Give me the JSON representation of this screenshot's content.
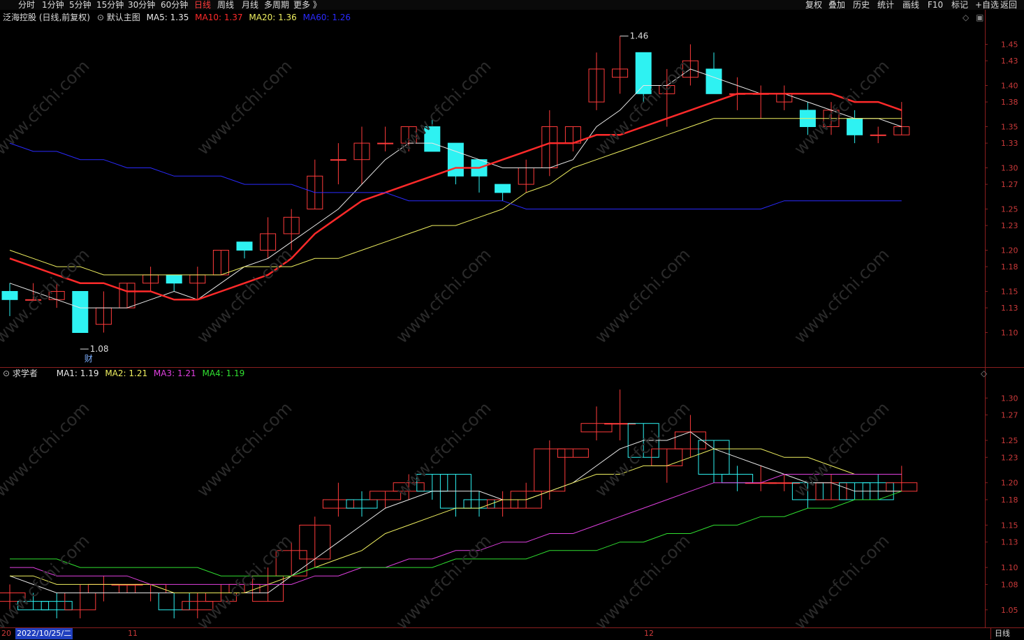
{
  "toolbar": {
    "left": [
      "分时",
      "1分钟",
      "5分钟",
      "15分钟",
      "30分钟",
      "60分钟",
      "日线",
      "周线",
      "月线",
      "多周期",
      "更多 》"
    ],
    "active_index": 6,
    "right": [
      "复权",
      "叠加",
      "历史",
      "统计",
      "画线",
      "F10",
      "标记",
      "+自选",
      "返回"
    ]
  },
  "main_panel": {
    "title": "泛海控股 (日线,前复权)",
    "indicator": "默认主图",
    "ma": [
      {
        "label": "MA5: 1.35",
        "color": "#e8e8e8"
      },
      {
        "label": "MA10: 1.37",
        "color": "#ff2a2a"
      },
      {
        "label": "MA20: 1.36",
        "color": "#f0f060"
      },
      {
        "label": "MA60: 1.26",
        "color": "#2a2aff"
      }
    ],
    "high_label": "1.46",
    "low_label": "1.08",
    "fin_marker": "财"
  },
  "sub_panel": {
    "title": "求学者",
    "ma": [
      {
        "label": "MA1: 1.19",
        "color": "#e8e8e8"
      },
      {
        "label": "MA2: 1.21",
        "color": "#f0f060"
      },
      {
        "label": "MA3: 1.21",
        "color": "#e040e0"
      },
      {
        "label": "MA4: 1.19",
        "color": "#30e030"
      }
    ]
  },
  "bottom": {
    "cursor_date": "2022/10/25/二",
    "x_ticks": [
      "20",
      "11",
      "12"
    ],
    "period": "日线"
  },
  "watermark": "www.cfchi.com",
  "colors": {
    "up": "#ff3b3b",
    "down": "#2ef2f2",
    "axis": "#8a1f1f",
    "axis_text": "#cc3a3a"
  },
  "chart_data": [
    {
      "type": "candlestick",
      "title": "泛海控股 (日线,前复权)",
      "y_ticks": [
        1.1,
        1.13,
        1.15,
        1.18,
        1.2,
        1.23,
        1.25,
        1.28,
        1.3,
        1.33,
        1.35,
        1.38,
        1.4,
        1.43,
        1.45
      ],
      "y_labels": [
        "1.10",
        "1.13",
        "1.15",
        "1.18",
        "1.20",
        "1.23",
        "1.25",
        "1.27",
        "1.30",
        "1.33",
        "1.35",
        "1.38",
        "1.40",
        "1.43",
        "1.45"
      ],
      "ylim": [
        1.075,
        1.475
      ],
      "candles": [
        [
          1.15,
          1.14,
          1.16,
          1.12
        ],
        [
          1.14,
          1.14,
          1.16,
          1.14
        ],
        [
          1.14,
          1.15,
          1.16,
          1.13
        ],
        [
          1.15,
          1.1,
          1.15,
          1.1
        ],
        [
          1.11,
          1.13,
          1.15,
          1.1
        ],
        [
          1.13,
          1.16,
          1.16,
          1.13
        ],
        [
          1.16,
          1.17,
          1.18,
          1.15
        ],
        [
          1.17,
          1.16,
          1.17,
          1.15
        ],
        [
          1.16,
          1.17,
          1.18,
          1.14
        ],
        [
          1.17,
          1.2,
          1.2,
          1.17
        ],
        [
          1.21,
          1.2,
          1.21,
          1.19
        ],
        [
          1.2,
          1.22,
          1.24,
          1.19
        ],
        [
          1.22,
          1.24,
          1.25,
          1.2
        ],
        [
          1.25,
          1.29,
          1.31,
          1.25
        ],
        [
          1.31,
          1.31,
          1.33,
          1.28
        ],
        [
          1.31,
          1.33,
          1.35,
          1.28
        ],
        [
          1.33,
          1.33,
          1.35,
          1.32
        ],
        [
          1.33,
          1.35,
          1.35,
          1.32
        ],
        [
          1.35,
          1.32,
          1.36,
          1.32
        ],
        [
          1.33,
          1.29,
          1.33,
          1.28
        ],
        [
          1.31,
          1.29,
          1.31,
          1.27
        ],
        [
          1.28,
          1.27,
          1.28,
          1.26
        ],
        [
          1.28,
          1.3,
          1.31,
          1.27
        ],
        [
          1.3,
          1.35,
          1.37,
          1.29
        ],
        [
          1.33,
          1.35,
          1.35,
          1.32
        ],
        [
          1.38,
          1.42,
          1.44,
          1.37
        ],
        [
          1.41,
          1.42,
          1.46,
          1.39
        ],
        [
          1.44,
          1.39,
          1.44,
          1.38
        ],
        [
          1.39,
          1.4,
          1.42,
          1.35
        ],
        [
          1.41,
          1.43,
          1.45,
          1.4
        ],
        [
          1.42,
          1.39,
          1.44,
          1.39
        ],
        [
          1.39,
          1.39,
          1.41,
          1.37
        ],
        [
          1.39,
          1.39,
          1.4,
          1.36
        ],
        [
          1.38,
          1.39,
          1.4,
          1.37
        ],
        [
          1.37,
          1.35,
          1.38,
          1.34
        ],
        [
          1.35,
          1.37,
          1.38,
          1.34
        ],
        [
          1.36,
          1.34,
          1.37,
          1.33
        ],
        [
          1.34,
          1.34,
          1.35,
          1.33
        ],
        [
          1.34,
          1.35,
          1.38,
          1.34
        ]
      ],
      "series": [
        {
          "name": "MA5",
          "values": [
            1.16,
            1.15,
            1.14,
            1.13,
            1.13,
            1.13,
            1.14,
            1.15,
            1.14,
            1.16,
            1.18,
            1.19,
            1.21,
            1.23,
            1.25,
            1.28,
            1.31,
            1.33,
            1.33,
            1.32,
            1.31,
            1.3,
            1.3,
            1.3,
            1.31,
            1.35,
            1.37,
            1.4,
            1.4,
            1.42,
            1.41,
            1.4,
            1.39,
            1.39,
            1.38,
            1.37,
            1.36,
            1.36,
            1.35
          ]
        },
        {
          "name": "MA10",
          "values": [
            1.19,
            1.18,
            1.17,
            1.16,
            1.16,
            1.15,
            1.15,
            1.14,
            1.14,
            1.15,
            1.16,
            1.17,
            1.19,
            1.22,
            1.24,
            1.26,
            1.27,
            1.28,
            1.29,
            1.3,
            1.3,
            1.31,
            1.32,
            1.33,
            1.33,
            1.34,
            1.34,
            1.35,
            1.36,
            1.37,
            1.38,
            1.39,
            1.39,
            1.39,
            1.39,
            1.39,
            1.38,
            1.38,
            1.37
          ]
        },
        {
          "name": "MA20",
          "values": [
            1.2,
            1.19,
            1.18,
            1.18,
            1.17,
            1.17,
            1.17,
            1.17,
            1.17,
            1.17,
            1.18,
            1.18,
            1.18,
            1.19,
            1.19,
            1.2,
            1.21,
            1.22,
            1.23,
            1.23,
            1.24,
            1.25,
            1.27,
            1.28,
            1.3,
            1.31,
            1.32,
            1.33,
            1.34,
            1.35,
            1.36,
            1.36,
            1.36,
            1.36,
            1.36,
            1.36,
            1.36,
            1.36,
            1.36
          ]
        },
        {
          "name": "MA60",
          "values": [
            1.33,
            1.32,
            1.32,
            1.31,
            1.31,
            1.3,
            1.3,
            1.29,
            1.29,
            1.29,
            1.28,
            1.28,
            1.28,
            1.27,
            1.27,
            1.27,
            1.27,
            1.26,
            1.26,
            1.26,
            1.26,
            1.26,
            1.25,
            1.25,
            1.25,
            1.25,
            1.25,
            1.25,
            1.25,
            1.25,
            1.25,
            1.25,
            1.25,
            1.26,
            1.26,
            1.26,
            1.26,
            1.26,
            1.26
          ]
        }
      ]
    },
    {
      "type": "candlestick",
      "title": "求学者",
      "y_ticks": [
        1.05,
        1.08,
        1.1,
        1.13,
        1.15,
        1.18,
        1.2,
        1.23,
        1.25,
        1.28,
        1.3
      ],
      "y_labels": [
        "1.05",
        "1.08",
        "1.10",
        "1.13",
        "1.15",
        "1.18",
        "1.20",
        "1.23",
        "1.25",
        "1.27",
        "1.30"
      ],
      "ylim": [
        1.035,
        1.32
      ],
      "candles": [
        [
          1.06,
          1.07,
          1.08,
          1.05
        ],
        [
          1.06,
          1.05,
          1.07,
          1.05
        ],
        [
          1.06,
          1.05,
          1.07,
          1.04
        ],
        [
          1.05,
          1.07,
          1.08,
          1.04
        ],
        [
          1.07,
          1.08,
          1.09,
          1.06
        ],
        [
          1.08,
          1.08,
          1.08,
          1.07
        ],
        [
          1.07,
          1.08,
          1.08,
          1.06
        ],
        [
          1.07,
          1.05,
          1.07,
          1.04
        ],
        [
          1.05,
          1.06,
          1.07,
          1.04
        ],
        [
          1.06,
          1.07,
          1.08,
          1.06
        ],
        [
          1.07,
          1.08,
          1.08,
          1.07
        ],
        [
          1.06,
          1.09,
          1.1,
          1.06
        ],
        [
          1.09,
          1.12,
          1.13,
          1.09
        ],
        [
          1.11,
          1.15,
          1.16,
          1.1
        ],
        [
          1.17,
          1.18,
          1.2,
          1.16
        ],
        [
          1.18,
          1.17,
          1.19,
          1.16
        ],
        [
          1.18,
          1.19,
          1.19,
          1.17
        ],
        [
          1.19,
          1.2,
          1.21,
          1.18
        ],
        [
          1.21,
          1.19,
          1.21,
          1.18
        ],
        [
          1.21,
          1.17,
          1.21,
          1.16
        ],
        [
          1.18,
          1.17,
          1.19,
          1.16
        ],
        [
          1.17,
          1.18,
          1.19,
          1.16
        ],
        [
          1.17,
          1.19,
          1.2,
          1.17
        ],
        [
          1.19,
          1.24,
          1.25,
          1.18
        ],
        [
          1.23,
          1.24,
          1.24,
          1.23
        ],
        [
          1.26,
          1.27,
          1.29,
          1.25
        ],
        [
          1.27,
          1.27,
          1.31,
          1.25
        ],
        [
          1.27,
          1.23,
          1.27,
          1.23
        ],
        [
          1.22,
          1.24,
          1.24,
          1.2
        ],
        [
          1.24,
          1.26,
          1.28,
          1.23
        ],
        [
          1.25,
          1.21,
          1.25,
          1.2
        ],
        [
          1.21,
          1.2,
          1.22,
          1.19
        ],
        [
          1.2,
          1.2,
          1.22,
          1.19
        ],
        [
          1.2,
          1.2,
          1.21,
          1.19
        ],
        [
          1.2,
          1.18,
          1.2,
          1.17
        ],
        [
          1.18,
          1.2,
          1.21,
          1.18
        ],
        [
          1.2,
          1.18,
          1.2,
          1.18
        ],
        [
          1.2,
          1.18,
          1.21,
          1.18
        ],
        [
          1.19,
          1.2,
          1.22,
          1.19
        ]
      ],
      "series": [
        {
          "name": "MA1",
          "values": [
            1.09,
            1.08,
            1.07,
            1.07,
            1.07,
            1.07,
            1.07,
            1.07,
            1.07,
            1.07,
            1.07,
            1.07,
            1.09,
            1.11,
            1.13,
            1.15,
            1.17,
            1.18,
            1.19,
            1.19,
            1.19,
            1.18,
            1.18,
            1.19,
            1.2,
            1.22,
            1.24,
            1.25,
            1.25,
            1.26,
            1.24,
            1.23,
            1.22,
            1.21,
            1.2,
            1.2,
            1.19,
            1.19,
            1.19
          ]
        },
        {
          "name": "MA2",
          "values": [
            1.09,
            1.09,
            1.08,
            1.08,
            1.08,
            1.08,
            1.08,
            1.07,
            1.07,
            1.07,
            1.07,
            1.08,
            1.09,
            1.1,
            1.11,
            1.12,
            1.14,
            1.15,
            1.16,
            1.17,
            1.17,
            1.18,
            1.18,
            1.19,
            1.2,
            1.21,
            1.21,
            1.22,
            1.22,
            1.23,
            1.24,
            1.24,
            1.24,
            1.23,
            1.23,
            1.22,
            1.21,
            1.21,
            1.21
          ]
        },
        {
          "name": "MA3",
          "values": [
            1.1,
            1.1,
            1.09,
            1.09,
            1.09,
            1.09,
            1.08,
            1.08,
            1.08,
            1.08,
            1.08,
            1.08,
            1.08,
            1.09,
            1.09,
            1.1,
            1.1,
            1.11,
            1.11,
            1.12,
            1.12,
            1.13,
            1.13,
            1.14,
            1.14,
            1.15,
            1.16,
            1.17,
            1.18,
            1.19,
            1.2,
            1.2,
            1.2,
            1.21,
            1.21,
            1.21,
            1.21,
            1.21,
            1.21
          ]
        },
        {
          "name": "MA4",
          "values": [
            1.11,
            1.11,
            1.11,
            1.1,
            1.1,
            1.1,
            1.1,
            1.1,
            1.1,
            1.09,
            1.09,
            1.09,
            1.09,
            1.1,
            1.1,
            1.1,
            1.1,
            1.1,
            1.1,
            1.11,
            1.11,
            1.11,
            1.11,
            1.12,
            1.12,
            1.12,
            1.13,
            1.13,
            1.14,
            1.14,
            1.15,
            1.15,
            1.16,
            1.16,
            1.17,
            1.17,
            1.18,
            1.18,
            1.19
          ]
        }
      ]
    }
  ]
}
